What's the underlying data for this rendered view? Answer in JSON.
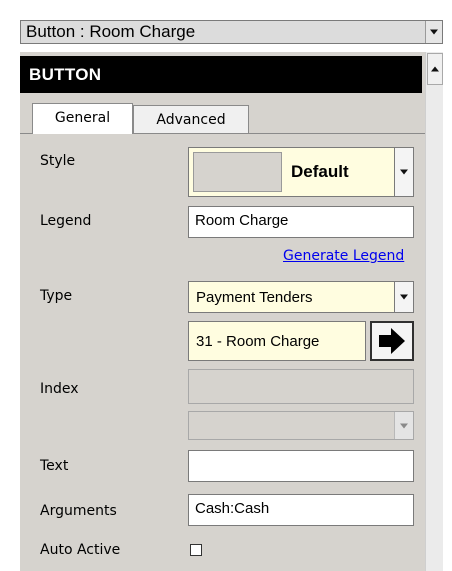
{
  "window": {
    "title": "Button : Room Charge"
  },
  "header": {
    "title": "BUTTON"
  },
  "tabs": [
    {
      "label": "General"
    },
    {
      "label": "Advanced"
    }
  ],
  "form": {
    "style": {
      "label": "Style",
      "value": "Default"
    },
    "legend": {
      "label": "Legend",
      "value": "Room Charge",
      "link": "Generate Legend"
    },
    "type": {
      "label": "Type",
      "value": "Payment Tenders",
      "sub_value": "31 - Room Charge"
    },
    "index": {
      "label": "Index",
      "value": ""
    },
    "text": {
      "label": "Text",
      "value": ""
    },
    "arguments": {
      "label": "Arguments",
      "value": "Cash:Cash"
    },
    "auto_active": {
      "label": "Auto Active",
      "checked": false
    }
  },
  "icons": {
    "dropdown": "chevron-down-icon",
    "go": "arrow-right-icon",
    "scroll_up": "scroll-up-icon"
  },
  "colors": {
    "header_bg": "#000000",
    "panel_bg": "#d6d3ce",
    "highlight_field": "#fffde0",
    "link": "#0000ee"
  }
}
